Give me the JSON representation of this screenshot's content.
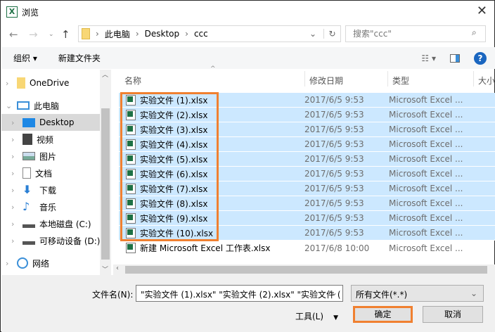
{
  "title": "浏览",
  "address": {
    "crumbs": [
      "此电脑",
      "Desktop",
      "ccc"
    ]
  },
  "search": {
    "placeholder": "搜索\"ccc\""
  },
  "toolbar": {
    "organize": "组织 ▾",
    "new_folder": "新建文件夹"
  },
  "sidebar": {
    "items": [
      {
        "label": "OneDrive",
        "icon": "folder-icon"
      },
      {
        "label": "此电脑",
        "icon": "computer-icon"
      },
      {
        "label": "Desktop",
        "icon": "desktop-icon"
      },
      {
        "label": "视频",
        "icon": "video-icon"
      },
      {
        "label": "图片",
        "icon": "picture-icon"
      },
      {
        "label": "文档",
        "icon": "document-icon"
      },
      {
        "label": "下载",
        "icon": "download-icon"
      },
      {
        "label": "音乐",
        "icon": "music-icon"
      },
      {
        "label": "本地磁盘 (C:)",
        "icon": "drive-icon"
      },
      {
        "label": "可移动设备 (D:)",
        "icon": "removable-drive-icon"
      },
      {
        "label": "网络",
        "icon": "network-icon"
      }
    ]
  },
  "columns": [
    "名称",
    "修改日期",
    "类型",
    "大小"
  ],
  "files": [
    {
      "name": "实验文件 (1).xlsx",
      "date": "2017/6/5 9:53",
      "type": "Microsoft Excel ..."
    },
    {
      "name": "实验文件 (2).xlsx",
      "date": "2017/6/5 9:53",
      "type": "Microsoft Excel ..."
    },
    {
      "name": "实验文件 (3).xlsx",
      "date": "2017/6/5 9:53",
      "type": "Microsoft Excel ..."
    },
    {
      "name": "实验文件 (4).xlsx",
      "date": "2017/6/5 9:53",
      "type": "Microsoft Excel ..."
    },
    {
      "name": "实验文件 (5).xlsx",
      "date": "2017/6/5 9:53",
      "type": "Microsoft Excel ..."
    },
    {
      "name": "实验文件 (6).xlsx",
      "date": "2017/6/5 9:53",
      "type": "Microsoft Excel ..."
    },
    {
      "name": "实验文件 (7).xlsx",
      "date": "2017/6/5 9:53",
      "type": "Microsoft Excel ..."
    },
    {
      "name": "实验文件 (8).xlsx",
      "date": "2017/6/5 9:53",
      "type": "Microsoft Excel ..."
    },
    {
      "name": "实验文件 (9).xlsx",
      "date": "2017/6/5 9:53",
      "type": "Microsoft Excel ..."
    },
    {
      "name": "实验文件 (10).xlsx",
      "date": "2017/6/5 9:53",
      "type": "Microsoft Excel ..."
    },
    {
      "name": "新建 Microsoft Excel 工作表.xlsx",
      "date": "2017/6/8 10:00",
      "type": "Microsoft Excel ..."
    }
  ],
  "footer": {
    "filename_label": "文件名(N):",
    "filename_value": "\"实验文件 (1).xlsx\" \"实验文件 (2).xlsx\" \"实验文件 (",
    "filter": "所有文件(*.*)",
    "tools": "工具(L)",
    "ok": "确定",
    "cancel": "取消"
  },
  "colors": {
    "selection": "#cce8ff",
    "highlight": "#f08030",
    "accent": "#0078d7"
  }
}
